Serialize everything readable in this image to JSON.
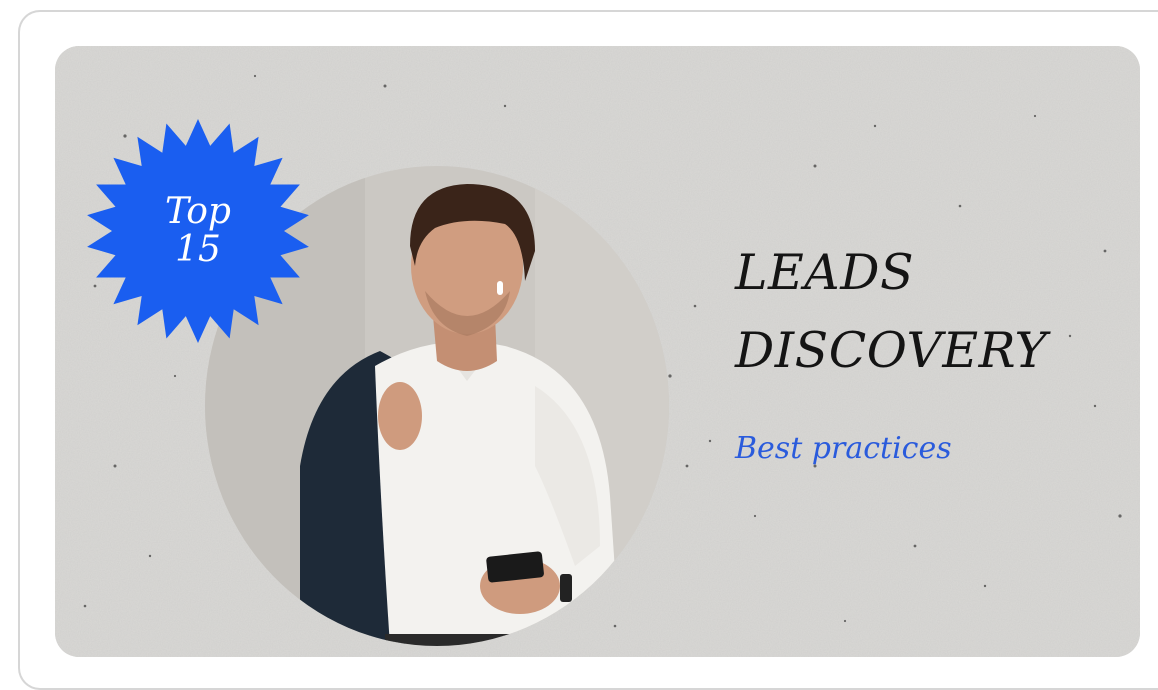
{
  "badge": {
    "line1": "Top",
    "line2": "15",
    "color": "#1a5ef0"
  },
  "headline": {
    "line1": "LEADS",
    "line2": "DISCOVERY"
  },
  "subtitle": "Best practices",
  "colors": {
    "accent": "#2a5bdc",
    "text": "#141414",
    "background": "#d9d8d6"
  },
  "icons": {
    "badge_shape": "starburst-icon",
    "photo": "man-with-phone-photo"
  }
}
